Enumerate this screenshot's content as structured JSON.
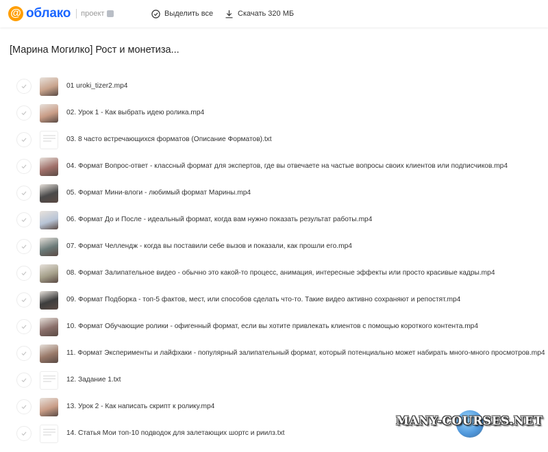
{
  "header": {
    "logo_text": "облако",
    "project_label": "проект",
    "select_all_label": "Выделить все",
    "download_label": "Скачать 320 МБ",
    "colors": {
      "logo_orange": "#ff9e00",
      "logo_blue": "#1b66ff"
    }
  },
  "folder": {
    "title": "[Марина Могилко] Рост и монетиза..."
  },
  "files": [
    {
      "name": "01 uroki_tizer2.mp4",
      "thumb": "video",
      "thumb_color": "#c8a38c"
    },
    {
      "name": "02. Урок 1 - Как выбрать идею ролика.mp4",
      "thumb": "video",
      "thumb_color": "#c89c86"
    },
    {
      "name": "03. 8 часто встречающихся форматов (Описание Форматов).txt",
      "thumb": "text"
    },
    {
      "name": "04. Формат Вопрос-ответ - классный формат для экспертов, где вы отвечаете на частые вопросы своих клиентов или подписчиков.mp4",
      "thumb": "video",
      "thumb_color": "#a0706a"
    },
    {
      "name": "05. Формат Мини-влоги - любимый формат Марины.mp4",
      "thumb": "video",
      "thumb_color": "#4a4a4a"
    },
    {
      "name": "06. Формат До и После - идеальный формат, когда вам нужно показать результат работы.mp4",
      "thumb": "video",
      "thumb_color": "#b8c4d6"
    },
    {
      "name": "07. Формат Челлендж - когда вы поставили себе вызов и показали, как прошли его.mp4",
      "thumb": "video",
      "thumb_color": "#6b7a78"
    },
    {
      "name": "08. Формат Залипательное видео - обычно это какой-то процесс, анимация, интересные эффекты или просто красивые кадры.mp4",
      "thumb": "video",
      "thumb_color": "#a5a08a"
    },
    {
      "name": "09. Формат Подборка - топ-5 фактов, мест, или способов сделать что-то. Такие видео активно сохраняют и репостят.mp4",
      "thumb": "video",
      "thumb_color": "#3d3d3d"
    },
    {
      "name": "10. Формат Обучающие ролики - офигенный формат, если вы хотите привлекать клиентов с помощью короткого контента.mp4",
      "thumb": "video",
      "thumb_color": "#8a6f6a"
    },
    {
      "name": "11. Формат Эксперименты и лайфхаки - популярный залипательный формат, который потенциально может набирать много-много просмотров.mp4",
      "thumb": "video",
      "thumb_color": "#9a7a6a"
    },
    {
      "name": "12. Задание 1.txt",
      "thumb": "text"
    },
    {
      "name": "13. Урок 2 - Как написать скрипт к ролику.mp4",
      "thumb": "video",
      "thumb_color": "#c89c86"
    },
    {
      "name": "14. Статья Мои топ-10 подводок для залетающих шортс и риилз.txt",
      "thumb": "text"
    }
  ],
  "watermark": {
    "text": "MANY-COURSES.NET"
  }
}
